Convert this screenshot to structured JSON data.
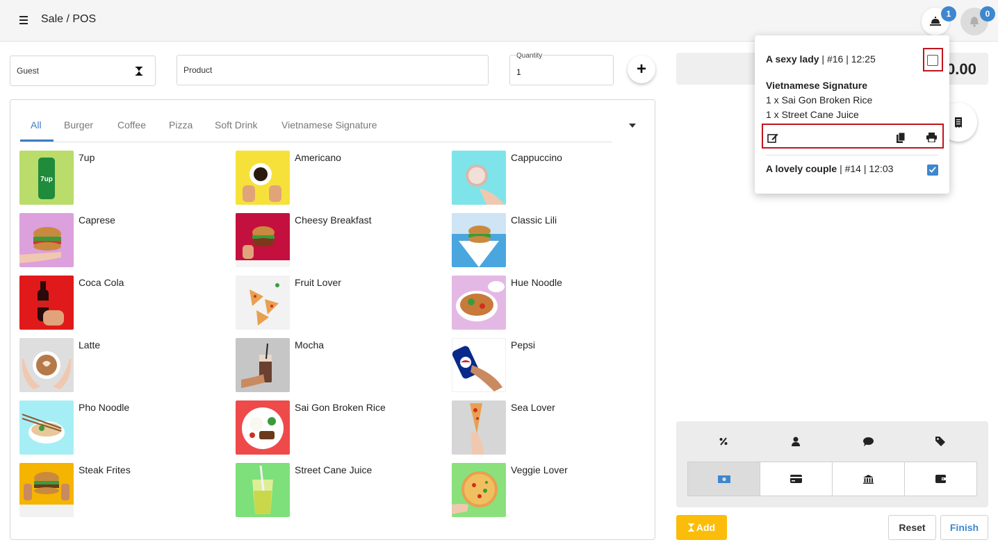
{
  "header": {
    "title": "Sale / POS",
    "orders_badge": "1",
    "notifications_badge": "0"
  },
  "inputs": {
    "guest_placeholder": "Guest",
    "product_placeholder": "Product",
    "quantity_label": "Quantity",
    "quantity_value": "1"
  },
  "tabs": [
    "All",
    "Burger",
    "Coffee",
    "Pizza",
    "Soft Drink",
    "Vietnamese Signature"
  ],
  "active_tab": "All",
  "products": [
    {
      "name": "7up"
    },
    {
      "name": "Americano"
    },
    {
      "name": "Cappuccino"
    },
    {
      "name": "Caprese"
    },
    {
      "name": "Cheesy Breakfast"
    },
    {
      "name": "Classic Lili"
    },
    {
      "name": "Coca Cola"
    },
    {
      "name": "Fruit Lover"
    },
    {
      "name": "Hue Noodle"
    },
    {
      "name": "Latte"
    },
    {
      "name": "Mocha"
    },
    {
      "name": "Pepsi"
    },
    {
      "name": "Pho Noodle"
    },
    {
      "name": "Sai Gon Broken Rice"
    },
    {
      "name": "Sea Lover"
    },
    {
      "name": "Steak Frites"
    },
    {
      "name": "Street Cane Juice"
    },
    {
      "name": "Veggie Lover"
    }
  ],
  "total": {
    "value": "0.00"
  },
  "buttons": {
    "add": "Add",
    "reset": "Reset",
    "finish": "Finish"
  },
  "popup": {
    "order1": {
      "guest": "A sexy lady",
      "meta": " | #16 | 12:25",
      "checked": false,
      "category": "Vietnamese Signature",
      "lines": [
        "1 x Sai Gon Broken Rice",
        "1 x Street Cane Juice"
      ]
    },
    "order2": {
      "guest": "A lovely couple",
      "meta": " | #14 | 12:03",
      "checked": true
    }
  },
  "colors": {
    "accent_blue": "#3d87cf",
    "tab_active": "#3d7cc4",
    "add_yellow": "#fbbd09",
    "highlight_red": "#c0141e"
  }
}
